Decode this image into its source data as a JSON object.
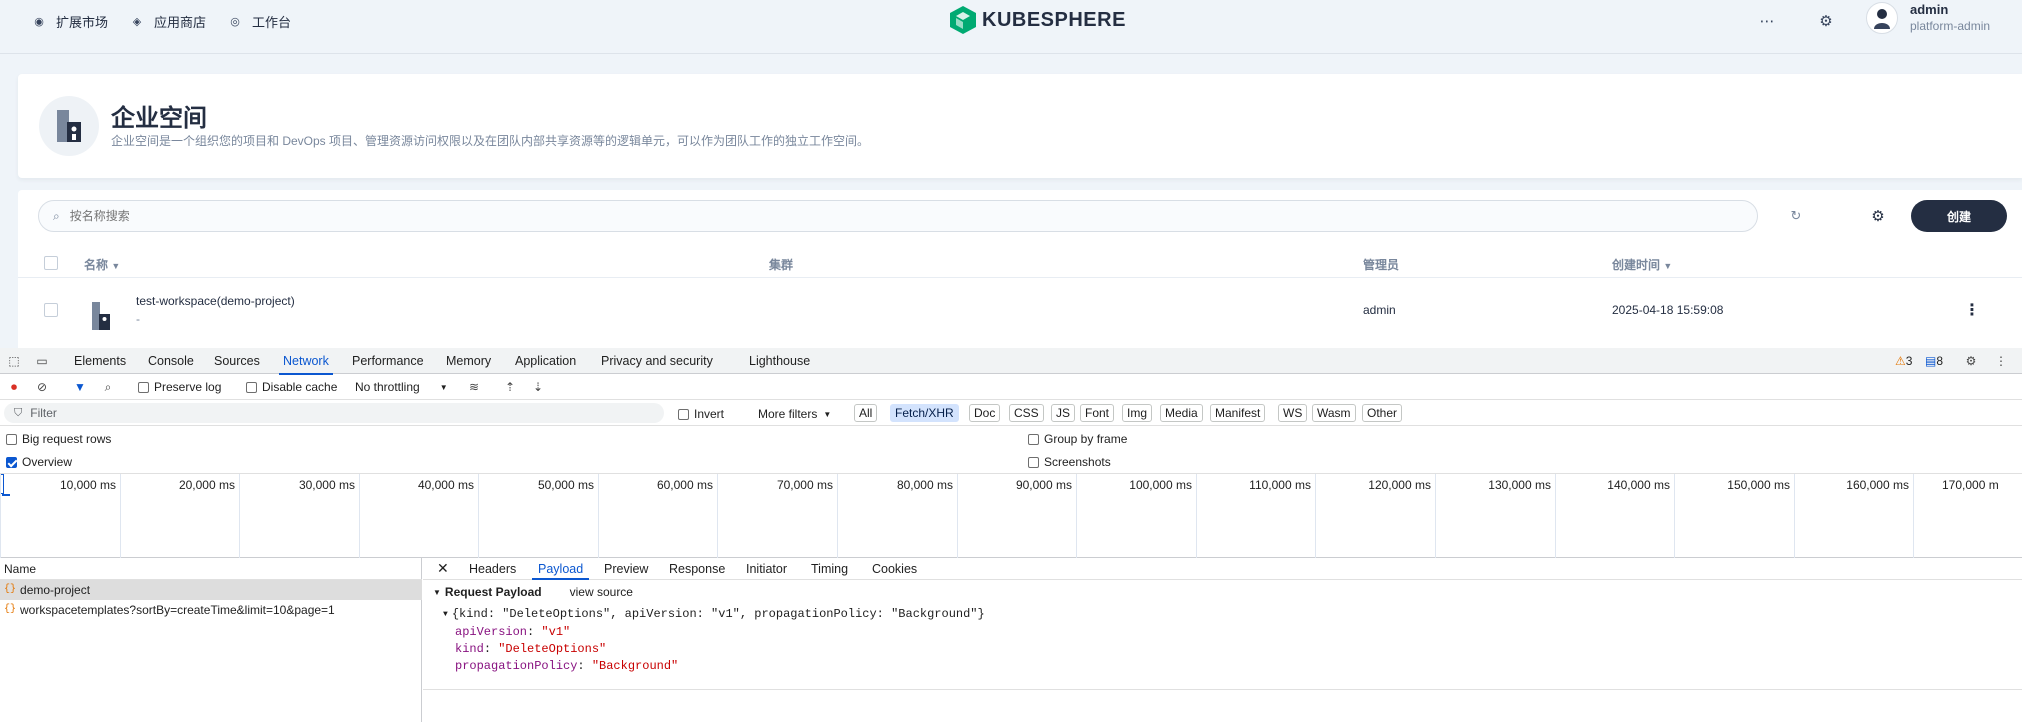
{
  "topnav": {
    "items": [
      {
        "label": "扩展市场",
        "icon": "puzzle-icon"
      },
      {
        "label": "应用商店",
        "icon": "layers-icon"
      },
      {
        "label": "工作台",
        "icon": "dashboard-icon"
      }
    ],
    "brand": "KUBESPHERE",
    "user": {
      "name": "admin",
      "role": "platform-admin"
    }
  },
  "banner": {
    "title": "企业空间",
    "description": "企业空间是一个组织您的项目和 DevOps 项目、管理资源访问权限以及在团队内部共享资源等的逻辑单元，可以作为团队工作的独立工作空间。"
  },
  "list": {
    "search_placeholder": "按名称搜索",
    "create_label": "创建",
    "columns": {
      "name": "名称",
      "cluster": "集群",
      "admin": "管理员",
      "created": "创建时间"
    },
    "rows": [
      {
        "name": "test-workspace(demo-project)",
        "sub": "-",
        "admin": "admin",
        "created": "2025-04-18 15:59:08"
      }
    ]
  },
  "devtools": {
    "tabs": [
      "Elements",
      "Console",
      "Sources",
      "Network",
      "Performance",
      "Memory",
      "Application",
      "Privacy and security",
      "Lighthouse"
    ],
    "active_tab": "Network",
    "warnings": "3",
    "messages": "8",
    "toolbar": {
      "preserve_log": "Preserve log",
      "disable_cache": "Disable cache",
      "throttling": "No throttling"
    },
    "filter": {
      "placeholder": "Filter",
      "invert": "Invert",
      "more_filters": "More filters",
      "types": [
        "All",
        "Fetch/XHR",
        "Doc",
        "CSS",
        "JS",
        "Font",
        "Img",
        "Media",
        "Manifest",
        "WS",
        "Wasm",
        "Other"
      ],
      "active_type": "Fetch/XHR"
    },
    "options": {
      "big_rows": "Big request rows",
      "overview": "Overview",
      "group_by_frame": "Group by frame",
      "screenshots": "Screenshots"
    },
    "timeline_ticks": [
      "10,000 ms",
      "20,000 ms",
      "30,000 ms",
      "40,000 ms",
      "50,000 ms",
      "60,000 ms",
      "70,000 ms",
      "80,000 ms",
      "90,000 ms",
      "100,000 ms",
      "110,000 ms",
      "120,000 ms",
      "130,000 ms",
      "140,000 ms",
      "150,000 ms",
      "160,000 ms",
      "170,000 m"
    ],
    "name_header": "Name",
    "requests": [
      "demo-project",
      "workspacetemplates?sortBy=createTime&limit=10&page=1"
    ],
    "detail_tabs": [
      "Headers",
      "Payload",
      "Preview",
      "Response",
      "Initiator",
      "Timing",
      "Cookies"
    ],
    "active_detail_tab": "Payload",
    "payload": {
      "title": "Request Payload",
      "view_source": "view source",
      "summary": "{kind: \"DeleteOptions\", apiVersion: \"v1\", propagationPolicy: \"Background\"}",
      "fields": [
        {
          "key": "apiVersion",
          "value": "\"v1\""
        },
        {
          "key": "kind",
          "value": "\"DeleteOptions\""
        },
        {
          "key": "propagationPolicy",
          "value": "\"Background\""
        }
      ]
    }
  },
  "colors": {
    "accent": "#0b57d0",
    "brand_green": "#00aa72",
    "dark": "#242e42"
  }
}
